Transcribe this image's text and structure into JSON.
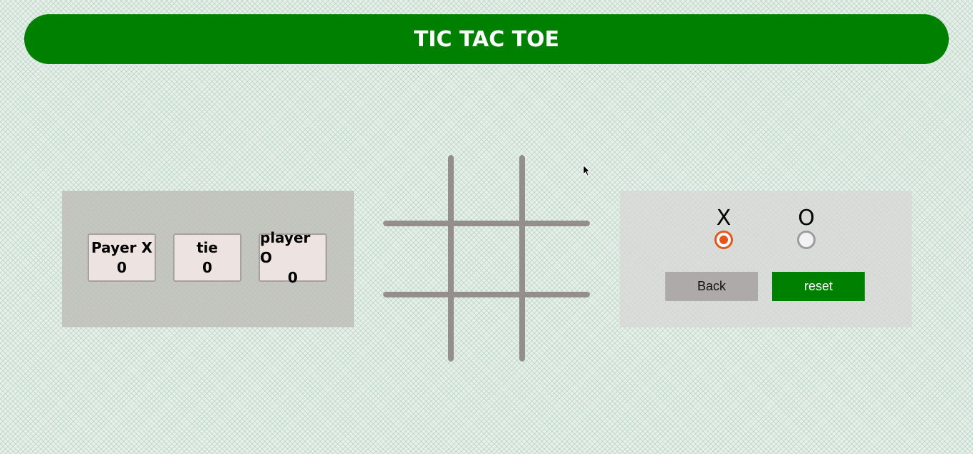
{
  "header": {
    "title": "TIC TAC TOE"
  },
  "scoreboard": {
    "player_x": {
      "label": "Payer X",
      "score": "0"
    },
    "tie": {
      "label": "tie",
      "score": "0"
    },
    "player_o": {
      "label": "player O",
      "score": "0"
    }
  },
  "board": {
    "cells": [
      "",
      "",
      "",
      "",
      "",
      "",
      "",
      "",
      ""
    ]
  },
  "controls": {
    "choice_x": {
      "label": "X",
      "checked": true
    },
    "choice_o": {
      "label": "O",
      "checked": false
    },
    "back_label": "Back",
    "reset_label": "reset"
  },
  "colors": {
    "brand_green": "#008000",
    "radio_accent": "#e8551a",
    "grid_line": "#948e8c"
  }
}
